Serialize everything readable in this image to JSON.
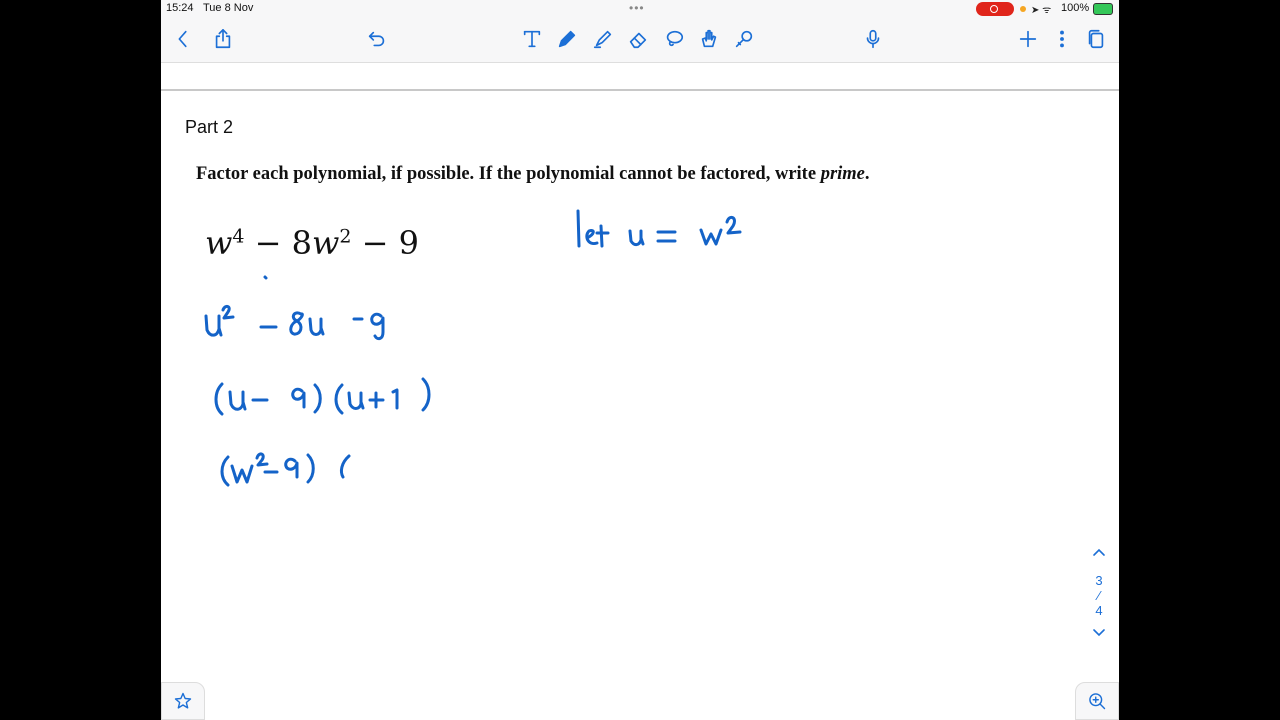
{
  "status_bar": {
    "time": "15:24",
    "date": "Tue 8 Nov",
    "battery": "100%"
  },
  "toolbar": {
    "back_icon": "chevron-left-icon",
    "share_icon": "share-icon",
    "undo_icon": "undo-icon",
    "tools": [
      "text-tool-icon",
      "pen-icon",
      "highlighter-icon",
      "eraser-icon",
      "lasso-icon",
      "hand-shape-icon",
      "laser-pointer-icon"
    ],
    "mic_icon": "microphone-icon",
    "add_icon": "plus-icon",
    "more_icon": "more-icon",
    "pages_icon": "pages-icon",
    "accent_color": "#1c6fd6"
  },
  "page": {
    "part_title": "Part 2",
    "instruction": "Factor each polynomial, if possible. If the polynomial cannot be factored, write ",
    "instruction_italic": "prime",
    "instruction_end": ".",
    "expression": {
      "w1": "w",
      "e1": "4",
      "mid": " − 8",
      "w2": "w",
      "e2": "2",
      "end": " − 9"
    },
    "ink_color": "#1463c8"
  },
  "page_nav": {
    "current": "3",
    "separator": "⁄",
    "total": "4"
  }
}
